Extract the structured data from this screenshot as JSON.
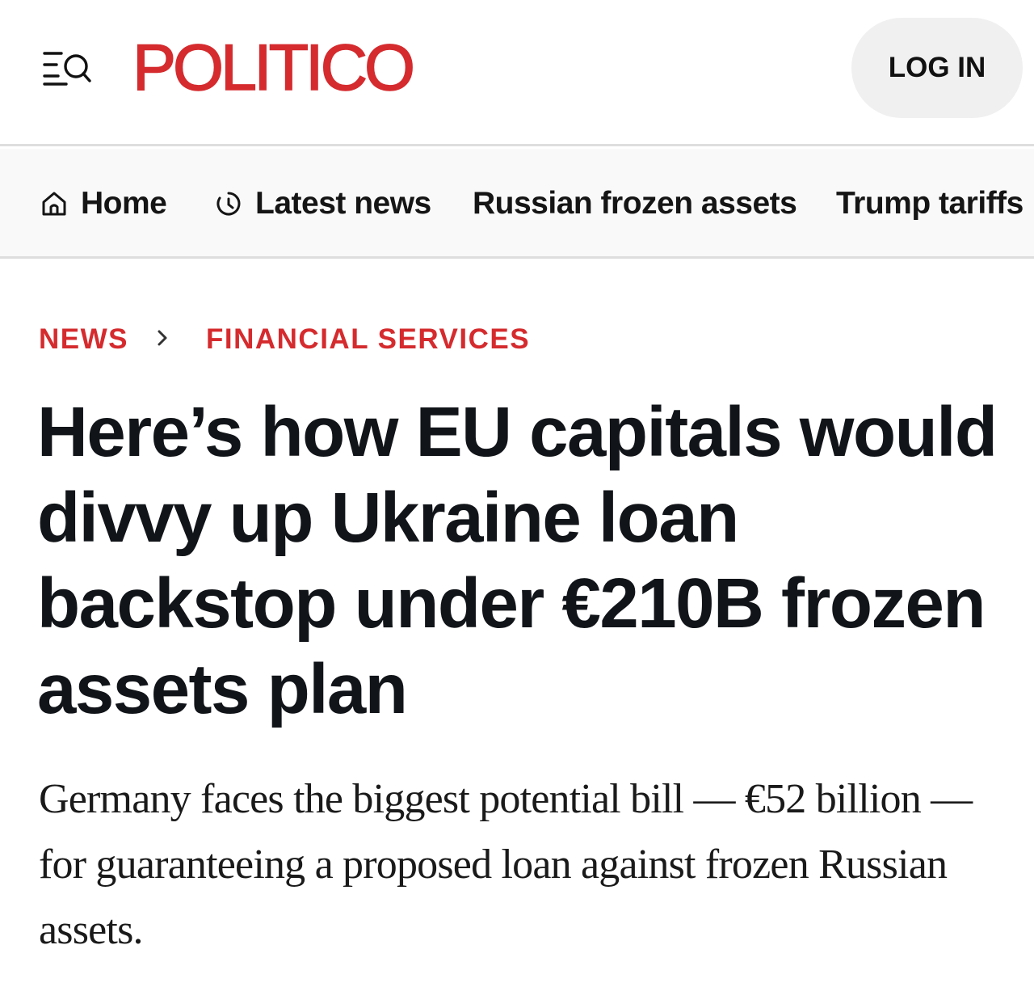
{
  "header": {
    "logo_text": "POLITICO",
    "brand_color": "#d52b2e",
    "menu_icon": "menu-search-icon",
    "login_label": "LOG IN"
  },
  "nav": {
    "items": [
      {
        "label": "Home",
        "icon": "home-icon"
      },
      {
        "label": "Latest news",
        "icon": "clock-icon"
      },
      {
        "label": "Russian frozen assets"
      },
      {
        "label": "Trump tariffs"
      }
    ]
  },
  "breadcrumb": {
    "section": "NEWS",
    "separator_icon": "chevron-right-icon",
    "subsection": "FINANCIAL SERVICES"
  },
  "article": {
    "headline": "Here’s how EU capitals would divvy up Ukraine loan backstop under €210B frozen assets plan",
    "dek": "Germany faces the biggest potential bill — €52 billion — for guaranteeing a proposed loan against frozen Russian assets."
  }
}
